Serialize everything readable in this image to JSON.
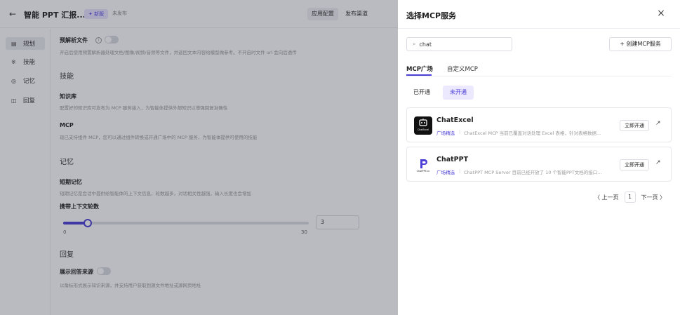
{
  "app": {
    "title": "智能 PPT 汇报...",
    "new_badge": "✦ 新版",
    "status": "未发布",
    "config_button": "应用配置",
    "publish_button": "发布渠道"
  },
  "nav": {
    "items": [
      {
        "icon": "▤",
        "label": "规划"
      },
      {
        "icon": "※",
        "label": "技能"
      },
      {
        "icon": "◎",
        "label": "记忆"
      },
      {
        "icon": "◫",
        "label": "回复"
      }
    ]
  },
  "content": {
    "preparse_title": "预解析文件",
    "preparse_desc": "开启后使用预置解析器处理文档/图像/视频/音频等文件，并返回文本内容给模型做参考。不开启时文件 url 会向后透传",
    "skills_title": "技能",
    "kb_title": "知识库",
    "kb_desc": "配置好的知识库可发布为 MCP 服务接入，为智能体提供外部知识以增强回复准确性",
    "mcp_title": "MCP",
    "mcp_desc": "现已支持组件 MCP，您可以通过组件转换或开通广场中的 MCP 服务，为智能体提供可使用的技能",
    "memory_title": "记忆",
    "short_mem_title": "短期记忆",
    "short_mem_desc": "短期记忆是会话中提供给智能体的上下文信息，轮数越多，对话相关性越强，输入长度也会增加",
    "rounds_label": "携带上下文轮数",
    "rounds_value": 3,
    "rounds_input": "3",
    "rounds_min": "0",
    "rounds_max": "30",
    "reply_title": "回复",
    "show_source_title": "展示回答来源",
    "show_source_desc": "以角标形式展示知识来源，并支持用户获取到源文件地址或源网页地址"
  },
  "drawer": {
    "title": "选择MCP服务",
    "close_icon": "×",
    "search_value": "chat",
    "search_icon": "⌕",
    "create_button": "+ 创建MCP服务",
    "tabs": [
      "MCP广场",
      "自定义MCP"
    ],
    "filters": [
      "已开通",
      "未开通"
    ],
    "cards": [
      {
        "name": "ChatExcel",
        "logo_label": "ChatExcel",
        "logo_color": "#111111",
        "tag": "广场精选",
        "desc": "ChatExcel MCP 当前已覆盖对话处理 Excel 表格，针对表格数据...",
        "action": "立即开通",
        "arrow": "↗"
      },
      {
        "name": "ChatPPT",
        "logo_label": "ChatPPT.cn",
        "logo_color": "#4b3fd6",
        "tag": "广场精选",
        "desc": "ChatPPT MCP Server 目前已经开放了 10 个智能PPT文档的接口...",
        "action": "立即开通",
        "arrow": "↗"
      }
    ],
    "pager": {
      "prev": "〈 上一页",
      "page": "1",
      "next": "下一页 〉"
    }
  },
  "colors": {
    "accent": "#4b3fd6",
    "overlay": "rgba(40,44,60,0.32)"
  }
}
